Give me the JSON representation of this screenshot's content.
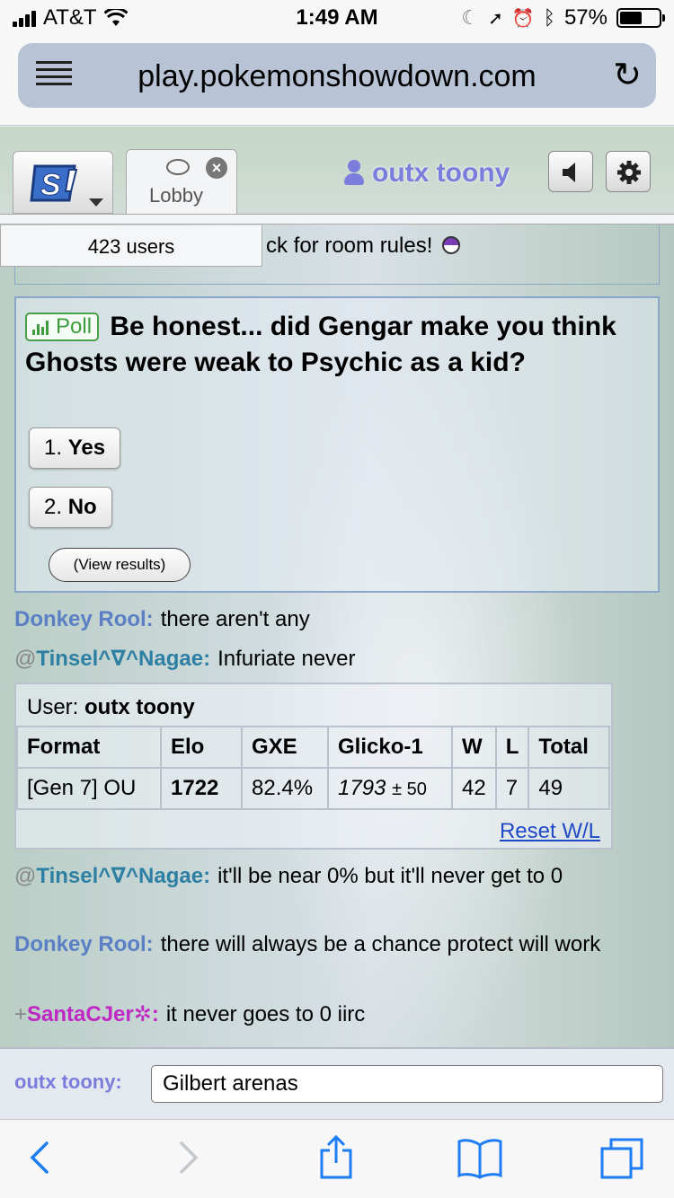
{
  "status_bar": {
    "carrier": "AT&T",
    "time": "1:49 AM",
    "battery": "57%",
    "battery_level": 0.57
  },
  "browser": {
    "url": "play.pokemonshowdown.com",
    "menu_icon": "reader-menu-icon",
    "reload_icon": "reload-icon"
  },
  "header": {
    "logo_icon": "showdown-logo-icon",
    "tab_label": "Lobby",
    "username": "outx toony",
    "sound_icon": "volume-icon",
    "settings_icon": "gear-icon"
  },
  "room": {
    "users_count": "423 users",
    "rules_text": "ck for room rules!"
  },
  "poll": {
    "tag": "Poll",
    "question": "Be honest... did Gengar make you think Ghosts were weak to Psychic as a kid?",
    "options": [
      {
        "num": "1.",
        "label": "Yes"
      },
      {
        "num": "2.",
        "label": "No"
      }
    ],
    "view_results": "(View results)"
  },
  "chat": [
    {
      "symbol": "",
      "user": "Donkey Rool:",
      "text": "there aren't any"
    },
    {
      "symbol": "@",
      "user": "Tinsel^∇^Nagae:",
      "text": "Infuriate never"
    },
    {
      "symbol": "@",
      "user": "Tinsel^∇^Nagae:",
      "text": "it'll be near 0% but it'll never get to 0"
    },
    {
      "symbol": "",
      "user": "Donkey Rool:",
      "text": "there will always be a chance protect will work"
    },
    {
      "symbol": "+",
      "user": "SantaCJer✲:",
      "text": "it never goes to 0 iirc"
    }
  ],
  "stats": {
    "user_label": "User:",
    "user_name": "outx toony",
    "headers": [
      "Format",
      "Elo",
      "GXE",
      "Glicko-1",
      "W",
      "L",
      "Total"
    ],
    "row": {
      "format": "[Gen 7] OU",
      "elo": "1722",
      "gxe": "82.4%",
      "glicko": "1793",
      "glicko_dev": "± 50",
      "w": "42",
      "l": "7",
      "total": "49"
    },
    "reset": "Reset W/L"
  },
  "composer": {
    "name": "outx toony:",
    "value": "Gilbert arenas"
  },
  "toolbar": {
    "back_icon": "back-arrow-icon",
    "forward_icon": "forward-arrow-icon",
    "share_icon": "share-icon",
    "bookmarks_icon": "bookmarks-icon",
    "tabs_icon": "tabs-icon"
  }
}
